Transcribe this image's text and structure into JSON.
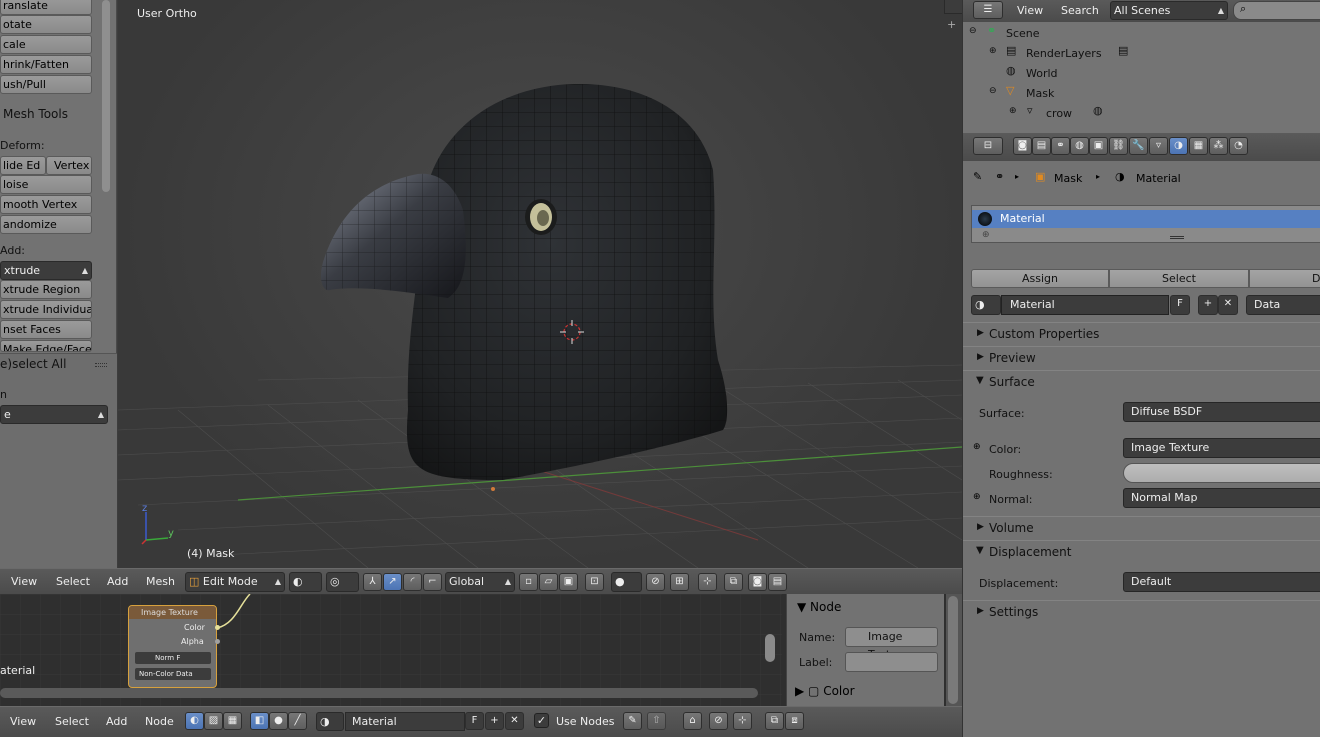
{
  "tool_shelf": {
    "transform_buttons": [
      "ranslate",
      "otate",
      "cale",
      "hrink/Fatten",
      "ush/Pull"
    ],
    "mesh_tools_title": "Mesh Tools",
    "deform_label": "Deform:",
    "deform_row": [
      "lide Ed",
      "Vertex"
    ],
    "deform_buttons": [
      "loise",
      "mooth Vertex",
      "andomize"
    ],
    "add_label": "Add:",
    "extrude_dropdown": "xtrude",
    "add_buttons": [
      "xtrude Region",
      "xtrude Individual",
      "nset Faces",
      "Make Edge/Face"
    ],
    "operator_title": "e)select All",
    "operator_label": "n",
    "operator_dropdown": "e"
  },
  "viewport": {
    "view_name": "User Ortho",
    "object_label": "(4) Mask",
    "axis_z": "z",
    "axis_y": "y"
  },
  "view3d_header": {
    "menus": [
      "View",
      "Select",
      "Add",
      "Mesh"
    ],
    "mode": "Edit Mode",
    "orientation": "Global"
  },
  "node_editor": {
    "node_title": "Image Texture",
    "out_color": "Color",
    "out_alpha": "Alpha",
    "norm_label": "Norm",
    "f_label": "F",
    "colorspace": "Non-Color Data",
    "left_text": "aterial",
    "side_panel": {
      "node_header": "Node",
      "name_label": "Name:",
      "name_value": "Image Text...",
      "label_label": "Label:",
      "label_value": "",
      "color_header": "Color"
    }
  },
  "node_header": {
    "menus": [
      "View",
      "Select",
      "Add",
      "Node"
    ],
    "material_name": "Material",
    "f_label": "F",
    "use_nodes_label": "Use Nodes",
    "use_nodes_checked": true
  },
  "outliner": {
    "menus": [
      "View",
      "Search"
    ],
    "scene_select": "All Scenes",
    "rows": [
      {
        "label": "Scene",
        "depth": 0,
        "icon": "scene-icon"
      },
      {
        "label": "RenderLayers",
        "depth": 1,
        "icon": "render-layers-icon"
      },
      {
        "label": "World",
        "depth": 1,
        "icon": "world-icon"
      },
      {
        "label": "Mask",
        "depth": 1,
        "icon": "object-icon"
      },
      {
        "label": "crow",
        "depth": 2,
        "icon": "mesh-icon"
      }
    ]
  },
  "properties": {
    "breadcrumb": [
      "Mask",
      "Material"
    ],
    "material_slot": "Material",
    "slot_buttons": [
      "Assign",
      "Select",
      "Dese"
    ],
    "material_field": "Material",
    "material_f": "F",
    "link_select": "Data",
    "panels": {
      "custom_properties": "Custom Properties",
      "preview": "Preview",
      "surface": "Surface",
      "volume": "Volume",
      "displacement": "Displacement",
      "settings": "Settings"
    },
    "surface_fields": [
      {
        "label": "Surface:",
        "value": "Diffuse BSDF"
      },
      {
        "label": "Color:",
        "value": "Image Texture"
      },
      {
        "label": "Roughness:",
        "value": ""
      },
      {
        "label": "Normal:",
        "value": "Normal Map"
      }
    ],
    "displacement_field": {
      "label": "Displacement:",
      "value": "Default"
    }
  },
  "colors": {
    "selection_blue": "#5680c2",
    "background": "#3d3d3d",
    "panel": "#727272"
  }
}
